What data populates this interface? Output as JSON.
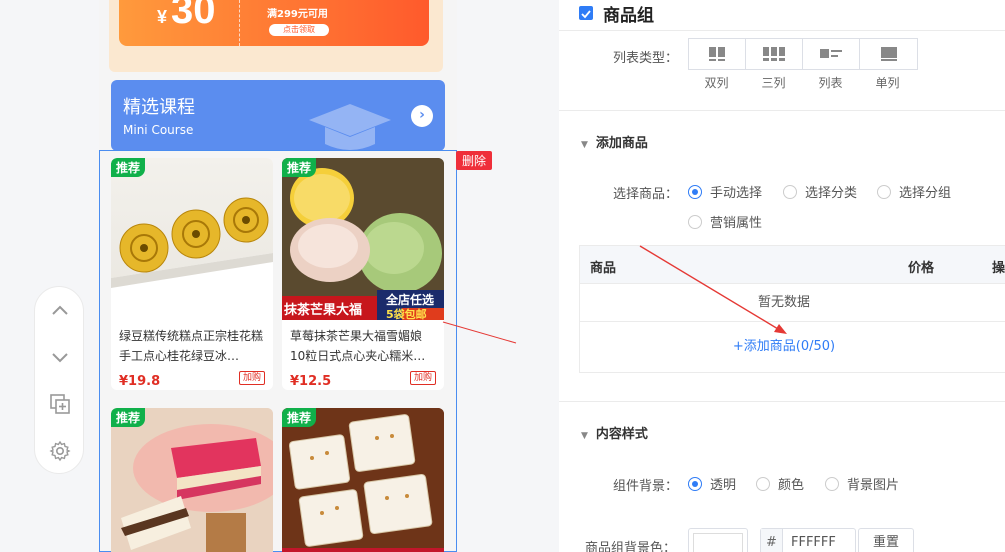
{
  "coupon": {
    "currency": "¥",
    "amount": "30",
    "condition": "满299元可用",
    "button": "点击领取"
  },
  "course": {
    "title": "精选课程",
    "subtitle": "Mini Course"
  },
  "delete_label": "删除",
  "goods": [
    {
      "tag": "推荐",
      "name": "绿豆糕传统糕点正宗桂花糕手工点心桂花绿豆冰…",
      "price": "¥19.8",
      "buy": "加购"
    },
    {
      "tag": "推荐",
      "name": "草莓抹茶芒果大福雪媚娘10粒日式点心夹心糯米…",
      "price": "¥12.5",
      "buy": "加购",
      "banner_left": "抹茶芒果大福",
      "banner_right_top": "全店任选",
      "banner_right_bottom": "5袋包邮"
    },
    {
      "tag": "推荐"
    },
    {
      "tag": "推荐"
    }
  ],
  "panel": {
    "title": "商品组",
    "list_type_label": "列表类型：",
    "list_types": [
      "双列",
      "三列",
      "列表",
      "单列"
    ],
    "add_goods_section": "添加商品",
    "select_goods_label": "选择商品：",
    "select_options": [
      "手动选择",
      "选择分类",
      "选择分组",
      "营销属性"
    ],
    "selected_option": "手动选择",
    "table_headers": {
      "goods": "商品",
      "price": "价格",
      "action": "操"
    },
    "empty_text": "暂无数据",
    "add_link": "+添加商品(0/50)",
    "content_style_section": "内容样式",
    "bg_label": "组件背景：",
    "bg_options": [
      "透明",
      "颜色",
      "背景图片"
    ],
    "bg_selected": "透明",
    "group_bg_label": "商品组背景色：",
    "hash": "#",
    "hex_value": "FFFFFF",
    "reset": "重置"
  },
  "colors": {
    "accent": "#2f7cf6",
    "tag_green": "#10b04a",
    "price_red": "#e02e24",
    "course_blue": "#5b8def"
  }
}
